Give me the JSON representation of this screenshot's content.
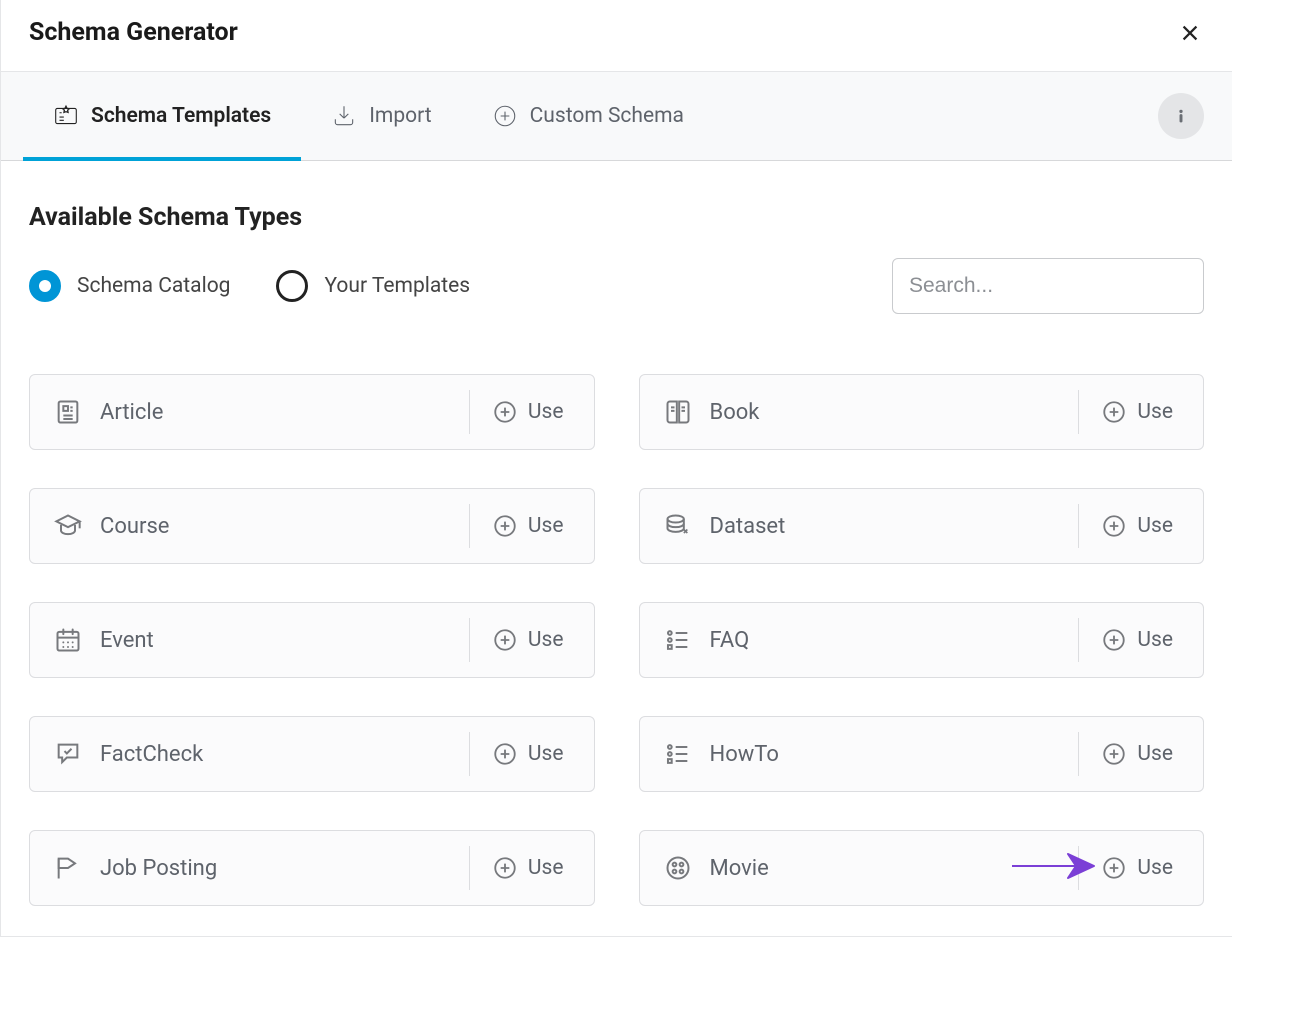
{
  "title": "Schema Generator",
  "tabs": {
    "templates": "Schema Templates",
    "import": "Import",
    "custom": "Custom Schema"
  },
  "section_heading": "Available Schema Types",
  "radios": {
    "catalog": "Schema Catalog",
    "your_templates": "Your Templates"
  },
  "search": {
    "placeholder": "Search..."
  },
  "use_label": "Use",
  "cards": [
    {
      "label": "Article"
    },
    {
      "label": "Book"
    },
    {
      "label": "Course"
    },
    {
      "label": "Dataset"
    },
    {
      "label": "Event"
    },
    {
      "label": "FAQ"
    },
    {
      "label": "FactCheck"
    },
    {
      "label": "HowTo"
    },
    {
      "label": "Job Posting"
    },
    {
      "label": "Movie"
    }
  ]
}
